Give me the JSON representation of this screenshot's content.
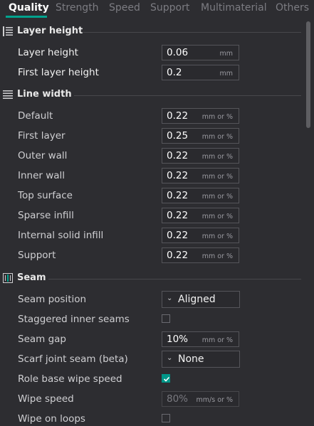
{
  "tabs": [
    "Quality",
    "Strength",
    "Speed",
    "Support",
    "Multimaterial",
    "Others"
  ],
  "sections": {
    "layer_height": {
      "title": "Layer height",
      "rows": [
        {
          "label": "Layer height",
          "value": "0.06",
          "unit": "mm"
        },
        {
          "label": "First layer height",
          "value": "0.2",
          "unit": "mm"
        }
      ]
    },
    "line_width": {
      "title": "Line width",
      "rows": [
        {
          "label": "Default",
          "value": "0.22",
          "unit": "mm or %"
        },
        {
          "label": "First layer",
          "value": "0.25",
          "unit": "mm or %"
        },
        {
          "label": "Outer wall",
          "value": "0.22",
          "unit": "mm or %"
        },
        {
          "label": "Inner wall",
          "value": "0.22",
          "unit": "mm or %"
        },
        {
          "label": "Top surface",
          "value": "0.22",
          "unit": "mm or %"
        },
        {
          "label": "Sparse infill",
          "value": "0.22",
          "unit": "mm or %"
        },
        {
          "label": "Internal solid infill",
          "value": "0.22",
          "unit": "mm or %"
        },
        {
          "label": "Support",
          "value": "0.22",
          "unit": "mm or %"
        }
      ]
    },
    "seam": {
      "title": "Seam",
      "seam_position": {
        "label": "Seam position",
        "value": "Aligned"
      },
      "staggered": {
        "label": "Staggered inner seams",
        "checked": false
      },
      "seam_gap": {
        "label": "Seam gap",
        "value": "10%",
        "unit": "mm or %"
      },
      "scarf": {
        "label": "Scarf joint seam (beta)",
        "value": "None"
      },
      "role_wipe": {
        "label": "Role base wipe speed",
        "checked": true
      },
      "wipe_speed": {
        "label": "Wipe speed",
        "value": "80%",
        "unit": "mm/s or %"
      },
      "wipe_loops": {
        "label": "Wipe on loops",
        "checked": false
      }
    }
  },
  "colors": {
    "accent": "#00a38e",
    "background": "#2d2d31"
  }
}
